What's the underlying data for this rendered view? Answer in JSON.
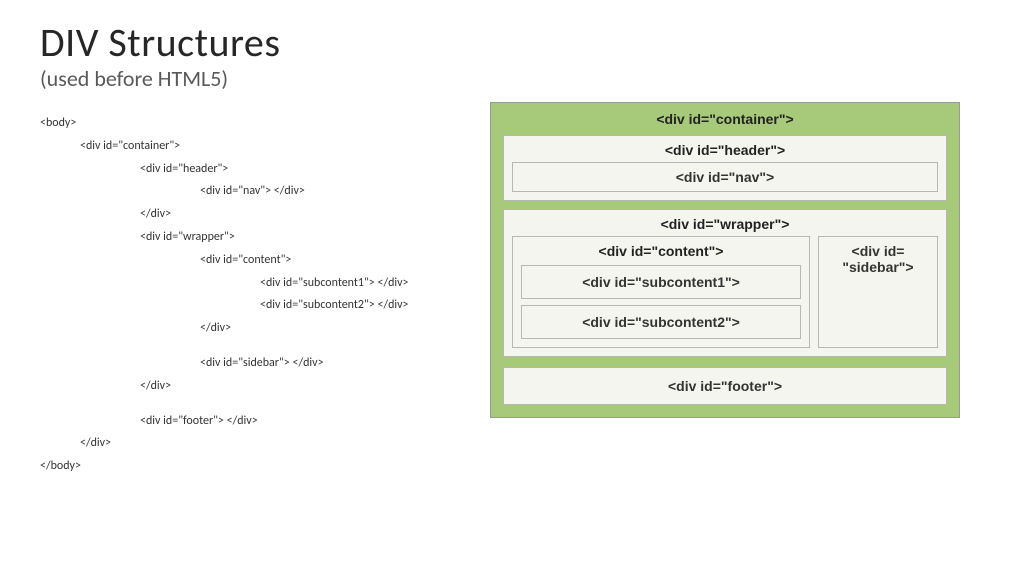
{
  "title": "DIV Structures",
  "subtitle": "(used before HTML5)",
  "code": {
    "l1": "<body>",
    "l2": "<div id=\"container\">",
    "l3": "<div id=\"header\">",
    "l4": "<div id=\"nav\">   </div>",
    "l5": "</div>",
    "l6": "<div id=\"wrapper\">",
    "l7": "<div id=\"content\">",
    "l8": "<div id=\"subcontent1\">   </div>",
    "l9": "<div id=\"subcontent2\">   </div>",
    "l10": "</div>",
    "l11": "<div id=\"sidebar\">   </div>",
    "l12": "</div>",
    "l13": "<div id=\"footer\">   </div>",
    "l14": "</div>",
    "l15": "</body>"
  },
  "diagram": {
    "container": "<div id=\"container\">",
    "header": "<div id=\"header\">",
    "nav": "<div id=\"nav\">",
    "wrapper": "<div id=\"wrapper\">",
    "content": "<div id=\"content\">",
    "subcontent1": "<div id=\"subcontent1\">",
    "subcontent2": "<div id=\"subcontent2\">",
    "sidebar1": "<div id=",
    "sidebar2": "\"sidebar\">",
    "footer": "<div id=\"footer\">"
  }
}
